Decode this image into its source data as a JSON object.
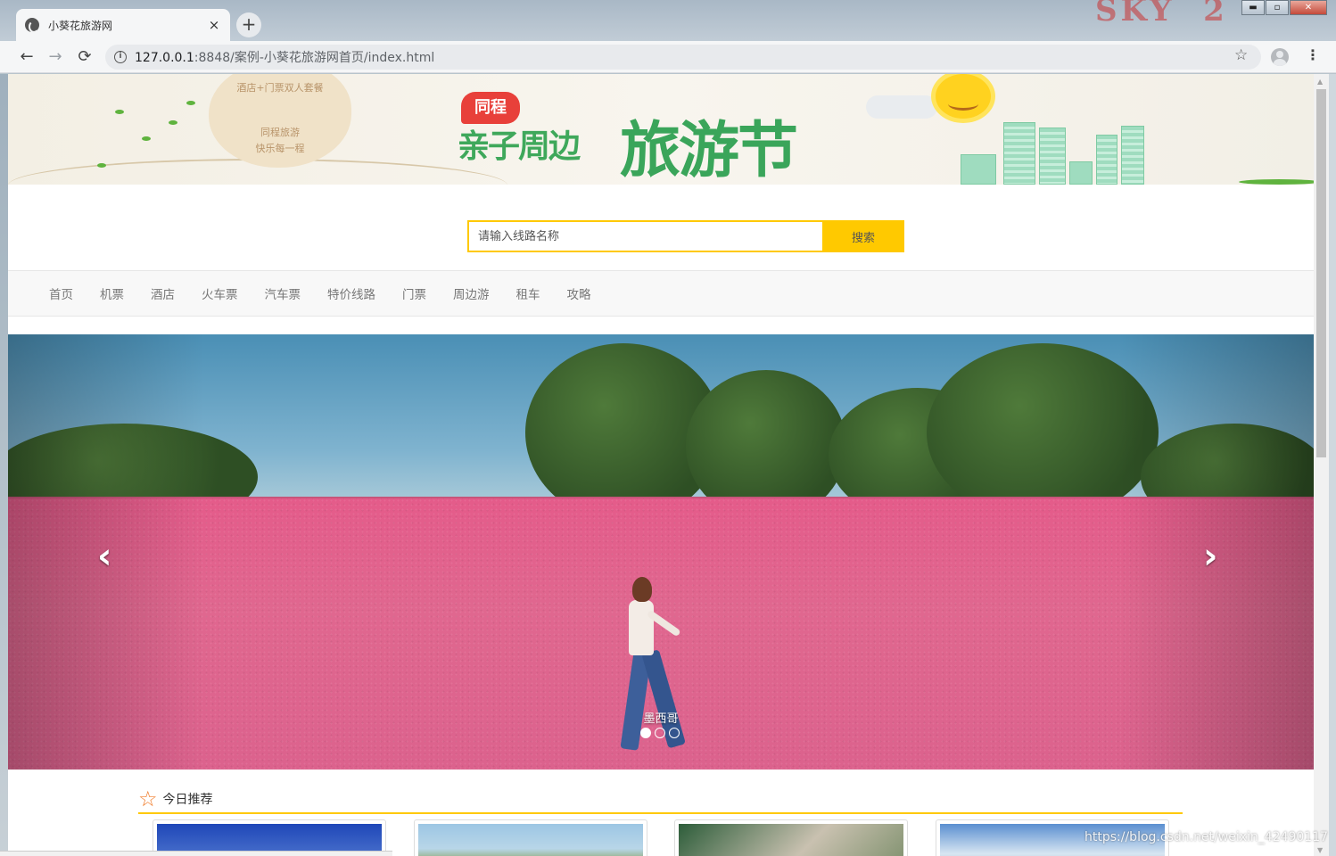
{
  "browser": {
    "tab_title": "小葵花旅游网",
    "tab_close": "×",
    "new_tab": "+",
    "url_host": "127.0.0.1",
    "url_rest": ":8848/案例-小葵花旅游网首页/index.html",
    "back": "←",
    "forward": "→",
    "reload": "⟳",
    "star": "☆",
    "menu": "⋮",
    "win_min": "▬",
    "win_max": "▫",
    "win_close": "✕"
  },
  "banner": {
    "cloud_line1": "酒店+门票双人套餐",
    "cloud_line2": "同程旅游",
    "cloud_line3": "快乐每一程",
    "logo_badge": "同程",
    "logo_sub": "亲子周边",
    "logo_main": "旅游节"
  },
  "search": {
    "placeholder": "请输入线路名称",
    "button": "搜索"
  },
  "nav": {
    "items": [
      "首页",
      "机票",
      "酒店",
      "火车票",
      "汽车票",
      "特价线路",
      "门票",
      "周边游",
      "租车",
      "攻略"
    ]
  },
  "carousel": {
    "caption": "墨西哥",
    "prev": "‹",
    "next": "›",
    "active_index": 0,
    "slide_count": 3
  },
  "recommend": {
    "title": "今日推荐",
    "star_icon": "☆"
  },
  "watermark": "https://blog.csdn.net/weixin_42490117"
}
